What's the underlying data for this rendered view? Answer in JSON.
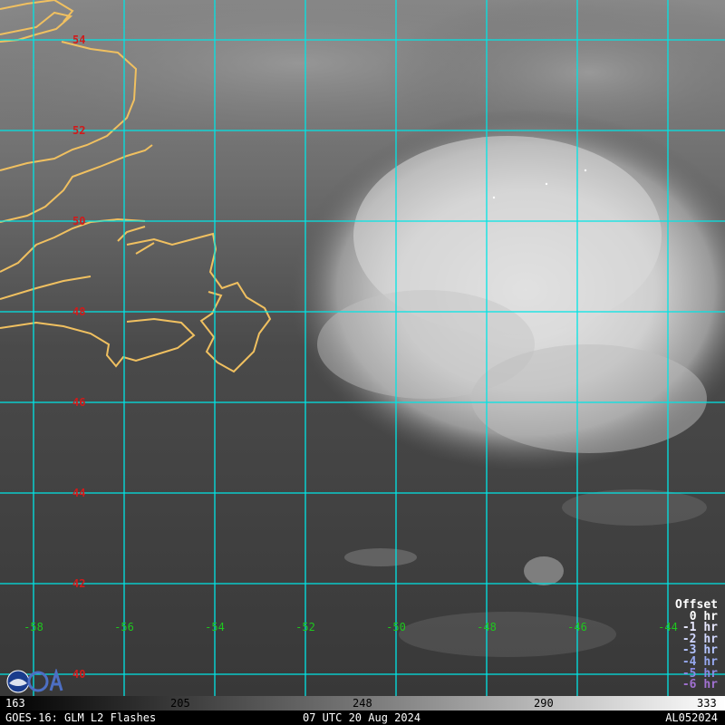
{
  "map": {
    "lat_labels": [
      "54",
      "52",
      "50",
      "48",
      "46",
      "44",
      "42",
      "40"
    ],
    "lon_labels": [
      "-58",
      "-56",
      "-54",
      "-52",
      "-50",
      "-48",
      "-46",
      "-44"
    ],
    "grid_color": "#00e5e5",
    "coast_color": "#f0c060",
    "lat_label_color": "#d21a1a",
    "lon_label_color": "#1ec81e"
  },
  "legend": {
    "title": "Offset",
    "items": [
      {
        "label": "0 hr",
        "color": "#ffffff"
      },
      {
        "label": "-1 hr",
        "color": "#e8e8ff"
      },
      {
        "label": "-2 hr",
        "color": "#d2d8ff"
      },
      {
        "label": "-3 hr",
        "color": "#b4c4ff"
      },
      {
        "label": "-4 hr",
        "color": "#96a8f0"
      },
      {
        "label": "-5 hr",
        "color": "#8a8ae6"
      },
      {
        "label": "-6 hr",
        "color": "#a070d0"
      }
    ]
  },
  "colorbar": {
    "ticks": [
      "163",
      "205",
      "248",
      "290",
      "333"
    ]
  },
  "footer": {
    "left": "GOES-16: GLM L2 Flashes",
    "center": "07 UTC 20 Aug 2024",
    "right": "AL052024"
  },
  "logo": {
    "icon": "noaa-logo-icon"
  }
}
